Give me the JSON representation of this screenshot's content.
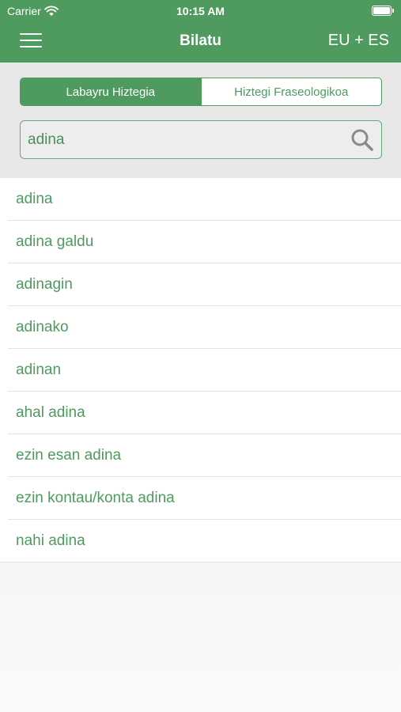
{
  "status_bar": {
    "carrier": "Carrier",
    "time": "10:15 AM",
    "battery_level": 1.0
  },
  "nav": {
    "title": "Bilatu",
    "language": "EU + ES",
    "menu_icon": "hamburger-menu-icon"
  },
  "segments": [
    {
      "label": "Labayru Hiztegia",
      "selected": true
    },
    {
      "label": "Hiztegi Fraseologikoa",
      "selected": false
    }
  ],
  "search": {
    "value": "adina",
    "placeholder": "",
    "icon": "search-icon"
  },
  "results": [
    "adina",
    "adina galdu",
    "adinagin",
    "adinako",
    "adinan",
    "ahal adina",
    "ezin esan adina",
    "ezin kontau/konta adina",
    "nahi adina"
  ],
  "colors": {
    "accent": "#4f9a5f",
    "panel": "#e8e8e8",
    "text_on_accent": "#ffffff"
  }
}
